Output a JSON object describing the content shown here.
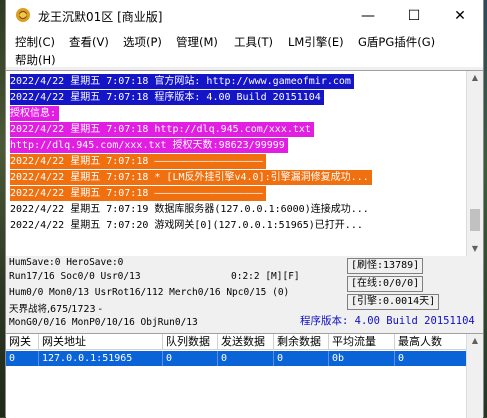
{
  "window": {
    "title": "龙王沉默01区 [商业版]",
    "controls": {
      "minimize": "—",
      "maximize": "☐",
      "close": "✕"
    }
  },
  "menu": [
    "控制(C)",
    "查看(V)",
    "选项(P)",
    "管理(M)",
    "工具(T)",
    "LM引擎(E)",
    "G盾PG插件(G)",
    "帮助(H)"
  ],
  "log": [
    {
      "text": "2022/4/22 星期五 7:07:18 官方网站: http://www.gameofmir.com",
      "color": "#ffffff",
      "bg": "#1515c8"
    },
    {
      "text": "2022/4/22 星期五 7:07:18 程序版本: 4.00 Build 20151104",
      "color": "#ffffff",
      "bg": "#1515c8"
    },
    {
      "text": "授权信息:",
      "color": "#ffffff",
      "bg": "#e21ee2"
    },
    {
      "text": "2022/4/22 星期五 7:07:18 http://dlq.945.com/xxx.txt",
      "color": "#ffffff",
      "bg": "#e21ee2"
    },
    {
      "text": "http://dlq.945.com/xxx.txt 授权天数:98623/99999",
      "color": "#ffffff",
      "bg": "#e21ee2"
    },
    {
      "text": "2022/4/22 星期五 7:07:18 ——————————————————",
      "color": "#ffffff",
      "bg": "#f07010"
    },
    {
      "text": "2022/4/22 星期五 7:07:18 * [LM反外挂引擎v4.0]:引擎漏洞修复成功...",
      "color": "#ffffff",
      "bg": "#f07010"
    },
    {
      "text": "2022/4/22 星期五 7:07:18 ——————————————————",
      "color": "#ffffff",
      "bg": "#f07010"
    },
    {
      "text": "2022/4/22 星期五 7:07:19 数据库服务器(127.0.0.1:6000)连接成功...",
      "color": "#000000",
      "bg": ""
    },
    {
      "text": "2022/4/22 星期五 7:07:20 游戏网关[0](127.0.0.1:51965)已打开...",
      "color": "#000000",
      "bg": ""
    }
  ],
  "status": {
    "line1": "HumSave:0 HeroSave:0",
    "line2a": "Run17/16 Soc0/0 Usr0/13",
    "line2b": "0:2:2 [M][F]",
    "line3": "Hum0/0 Mon0/13 UsrRot16/112 Merch0/16 Npc0/15 (0)",
    "line4": "天界战将,675/1723 -",
    "line5": "MonG0/0/16 MonP0/10/16 ObjRun0/13",
    "refresh": "[刷怪:13789]",
    "online": "[在线:0/0/0]",
    "engine": "[引擎:0.0014天]",
    "version": "程序版本: 4.00 Build 20151104"
  },
  "grid": {
    "headers": [
      "网关",
      "网关地址",
      "队列数据",
      "发送数据",
      "剩余数据",
      "平均流量",
      "最高人数"
    ],
    "rows": [
      [
        "0",
        "127.0.0.1:51965",
        "0",
        "0",
        "0",
        "0b",
        "0"
      ]
    ]
  }
}
